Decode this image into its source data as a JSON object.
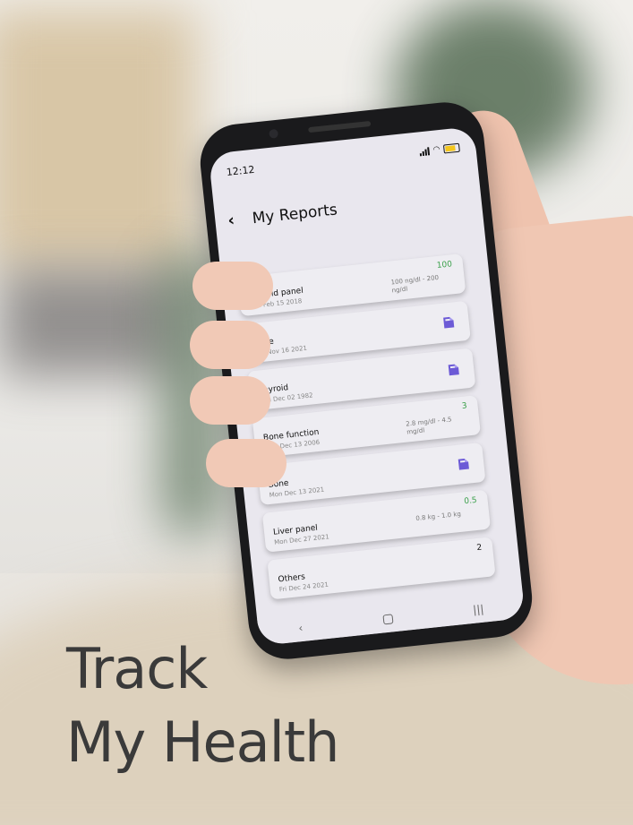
{
  "status": {
    "time": "12:12"
  },
  "header": {
    "title": "My Reports",
    "back_icon": "chevron-left-icon"
  },
  "reports": [
    {
      "name": "Thyroid panel",
      "date": "Thu Feb 15 2018",
      "value": "100",
      "range": "100 ng/dl - 200 ng/dl"
    },
    {
      "name": "Bone",
      "date": "Tue Nov 16 2021",
      "icon": "document-icon"
    },
    {
      "name": "Thyroid",
      "date": "Thu Dec 02 1982",
      "icon": "document-icon"
    },
    {
      "name": "Bone function",
      "date": "Wed Dec 13 2006",
      "value": "3",
      "range": "2.8 mg/dl - 4.5 mg/dl"
    },
    {
      "name": "Bone",
      "date": "Mon Dec 13 2021",
      "icon": "document-icon"
    },
    {
      "name": "Liver panel",
      "date": "Mon Dec 27 2021",
      "value": "0.5",
      "range": "0.8 kg - 1.0 kg"
    },
    {
      "name": "Others",
      "date": "Fri Dec 24 2021",
      "value": "2"
    }
  ],
  "navbar": {
    "back": "‹",
    "recent": "|||"
  },
  "headline": {
    "line1": "Track",
    "line2": "My Health"
  },
  "colors": {
    "accent": "#6c5ad6",
    "value_green": "#3aa04a",
    "screen_bg": "#e9e7ee"
  }
}
